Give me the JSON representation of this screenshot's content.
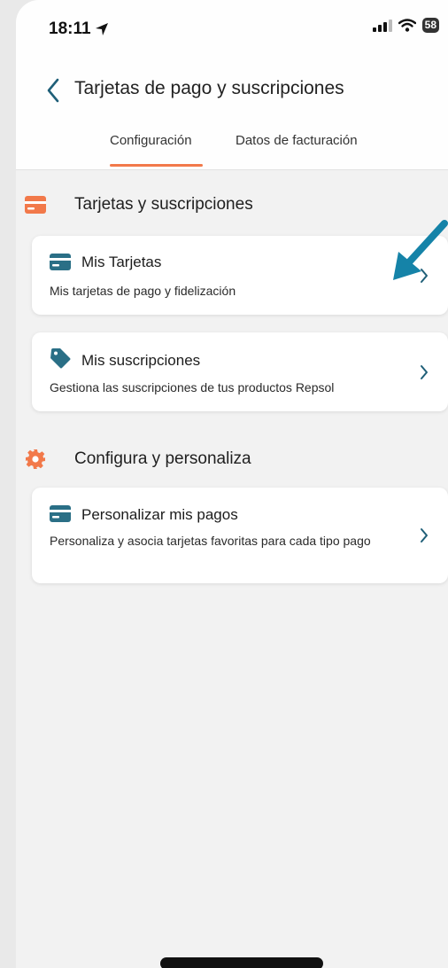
{
  "status_bar": {
    "time": "18:11",
    "battery": "58"
  },
  "header": {
    "title": "Tarjetas de pago y suscripciones"
  },
  "tabs": [
    {
      "label": "Configuración",
      "active": true
    },
    {
      "label": "Datos de facturación",
      "active": false
    }
  ],
  "sections": [
    {
      "title": "Tarjetas y suscripciones",
      "icon": "card-icon",
      "cards": [
        {
          "title": "Mis Tarjetas",
          "desc": "Mis tarjetas de pago y fidelización",
          "icon": "credit-card-icon"
        },
        {
          "title": "Mis suscripciones",
          "desc": "Gestiona las suscripciones de tus productos Repsol",
          "icon": "tag-icon"
        }
      ]
    },
    {
      "title": "Configura y personaliza",
      "icon": "gear-icon",
      "cards": [
        {
          "title": "Personalizar mis pagos",
          "desc": "Personaliza y asocia tarjetas favoritas para cada tipo pago",
          "icon": "credit-card-icon"
        }
      ]
    }
  ],
  "colors": {
    "accent": "#f2794a",
    "teal": "#2a6f86",
    "annotation_arrow": "#1583a8"
  }
}
